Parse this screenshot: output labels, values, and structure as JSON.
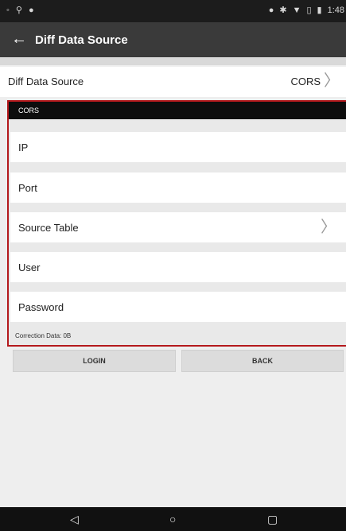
{
  "status_bar": {
    "left_icons": [
      "circle-icon",
      "signal-icon",
      "location-pin-icon"
    ],
    "right_icons": [
      "location-pin-icon",
      "bluetooth-icon",
      "wifi-icon",
      "no-sim-icon",
      "battery-icon"
    ],
    "time": "1:48"
  },
  "app_bar": {
    "back_icon": "arrow-left-icon",
    "title": "Diff Data Source"
  },
  "source_row": {
    "label": "Diff Data Source",
    "value": "CORS"
  },
  "panel": {
    "header": "CORS",
    "fields": [
      {
        "label": "IP"
      },
      {
        "label": "Port"
      },
      {
        "label": "Source Table",
        "has_chevron": true
      },
      {
        "label": "User"
      },
      {
        "label": "Password"
      }
    ],
    "correction_label": "Correction Data:",
    "correction_value": "0B"
  },
  "buttons": {
    "login": "LOGIN",
    "back": "BACK"
  },
  "nav_bar": {
    "icons": [
      "back-triangle-icon",
      "home-circle-icon",
      "recents-square-icon"
    ]
  },
  "colors": {
    "highlight_border": "#b4191c",
    "app_bar": "#3a3a3a",
    "status_bar": "#1c1c1c"
  }
}
